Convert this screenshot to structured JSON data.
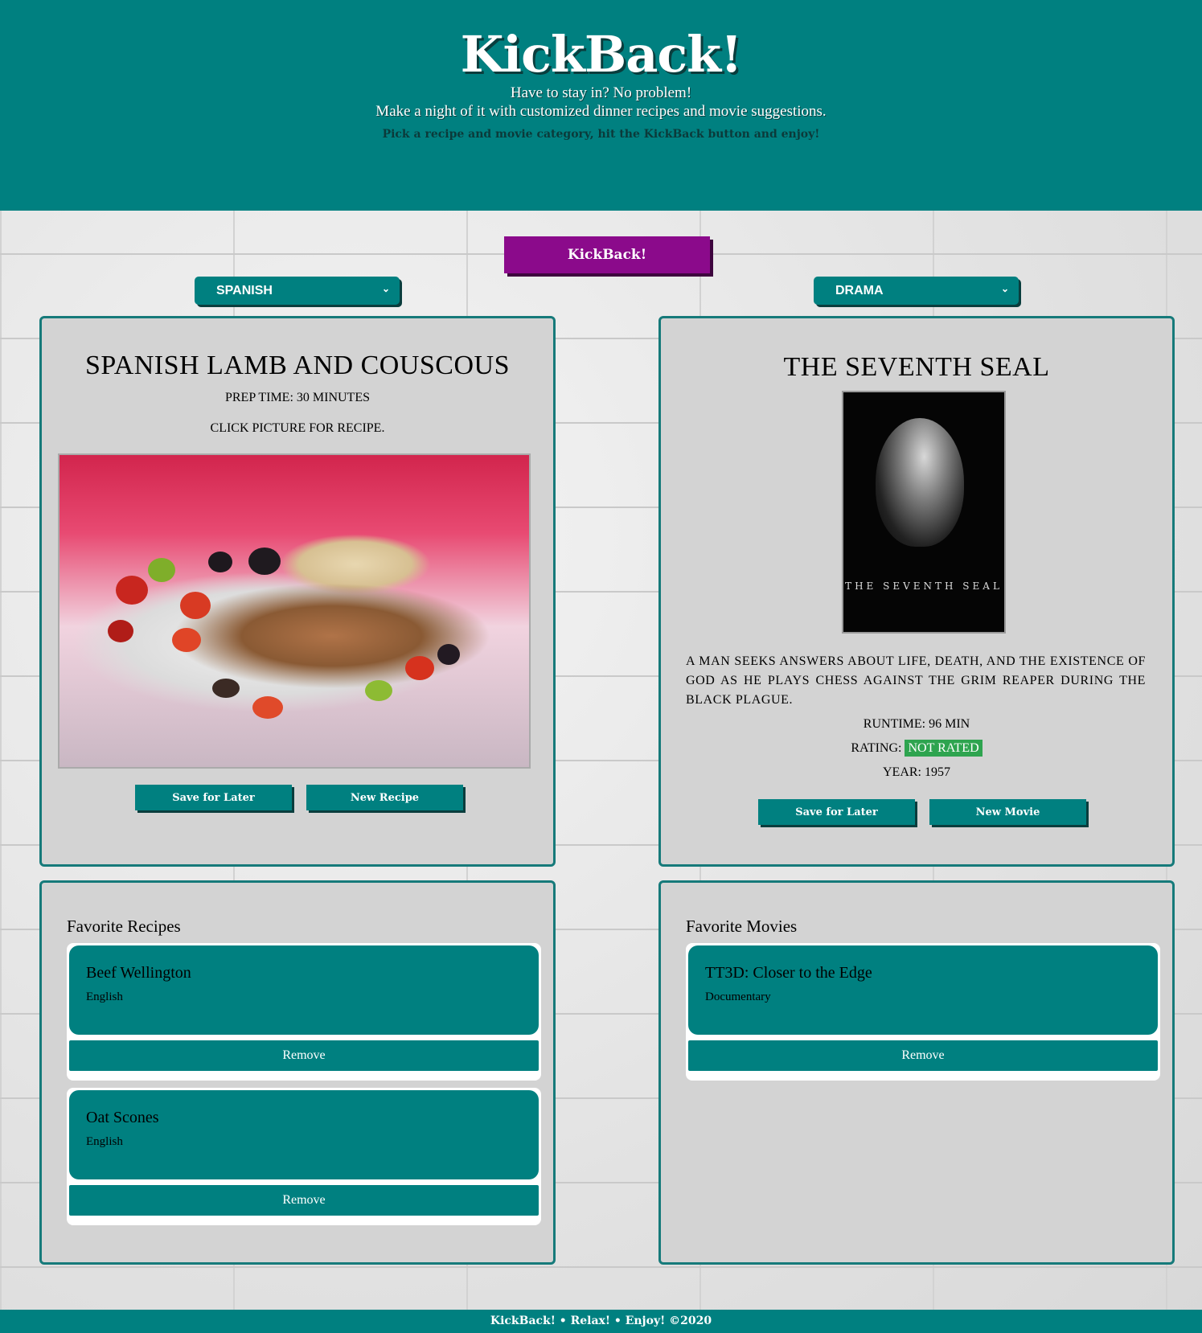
{
  "header": {
    "title": "KickBack!",
    "tagline_1": "Have to stay in? No problem!",
    "tagline_2": "Make a night of it with customized dinner recipes and movie suggestions.",
    "instructions": "Pick a recipe and movie category, hit the KickBack button and enjoy!"
  },
  "controls": {
    "kickback_label": "KickBack!",
    "recipe_category": "SPANISH",
    "movie_category": "DRAMA"
  },
  "recipe": {
    "title": "SPANISH LAMB AND COUSCOUS",
    "prep_time": "PREP TIME: 30 MINUTES",
    "hint": "CLICK PICTURE FOR RECIPE.",
    "save_label": "Save for Later",
    "new_label": "New Recipe"
  },
  "movie": {
    "title": "THE SEVENTH SEAL",
    "poster_title": "THE SEVENTH SEAL",
    "synopsis": "A MAN SEEKS ANSWERS ABOUT LIFE, DEATH, AND THE EXISTENCE OF GOD AS HE PLAYS CHESS AGAINST THE GRIM REAPER DURING THE BLACK PLAGUE.",
    "runtime": "RUNTIME: 96 MIN",
    "rating_label": "RATING:",
    "rating_value": "NOT RATED",
    "year": "YEAR: 1957",
    "save_label": "Save for Later",
    "new_label": "New Movie"
  },
  "favorite_recipes": {
    "heading": "Favorite Recipes",
    "items": [
      {
        "name": "Beef Wellington",
        "category": "English",
        "remove_label": "Remove"
      },
      {
        "name": "Oat Scones",
        "category": "English",
        "remove_label": "Remove"
      }
    ]
  },
  "favorite_movies": {
    "heading": "Favorite Movies",
    "items": [
      {
        "name": "TT3D: Closer to the Edge",
        "category": "Documentary",
        "remove_label": "Remove"
      }
    ]
  },
  "footer": {
    "text": "KickBack! • Relax! • Enjoy! ©2020"
  },
  "colors": {
    "teal": "#008080",
    "purple": "#8b0a8b",
    "rating_green": "#2ea44f",
    "card_bg": "#d3d3d3"
  }
}
